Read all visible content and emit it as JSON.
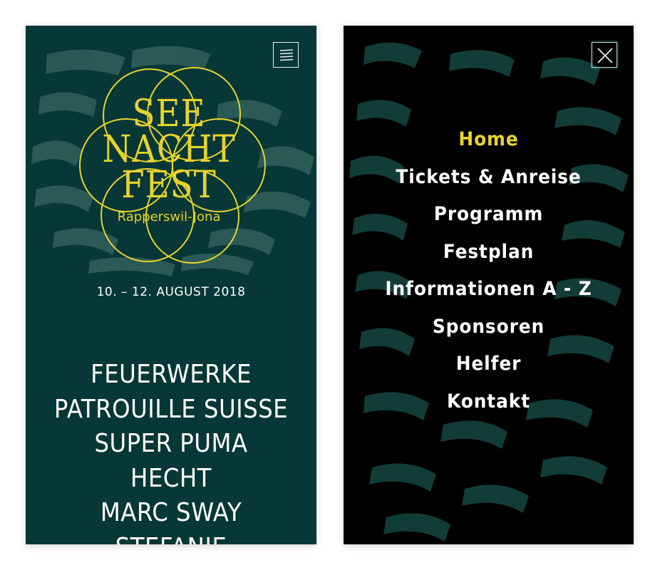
{
  "left_screen": {
    "logo": {
      "line1": "SEE",
      "line2": "NACHT",
      "line3": "FEST",
      "subtitle": "Rapperswil-Jona"
    },
    "date": "10. – 12. AUGUST 2018",
    "lineup": [
      "FEUERWERKE",
      "PATROUILLE SUISSE",
      "SUPER PUMA",
      "HECHT",
      "MARC SWAY",
      "STEFANIE"
    ],
    "menu_icon": "hamburger-icon"
  },
  "right_screen": {
    "close_icon": "close-icon",
    "nav": [
      "Home",
      "Tickets & Anreise",
      "Programm",
      "Festplan",
      "Informationen A - Z",
      "Sponsoren",
      "Helfer",
      "Kontakt"
    ],
    "active_item": "Home"
  },
  "colors": {
    "teal_background": "#073737",
    "black_background": "#000000",
    "accent_yellow": "#e8d32c",
    "text_white": "#ffffff"
  }
}
